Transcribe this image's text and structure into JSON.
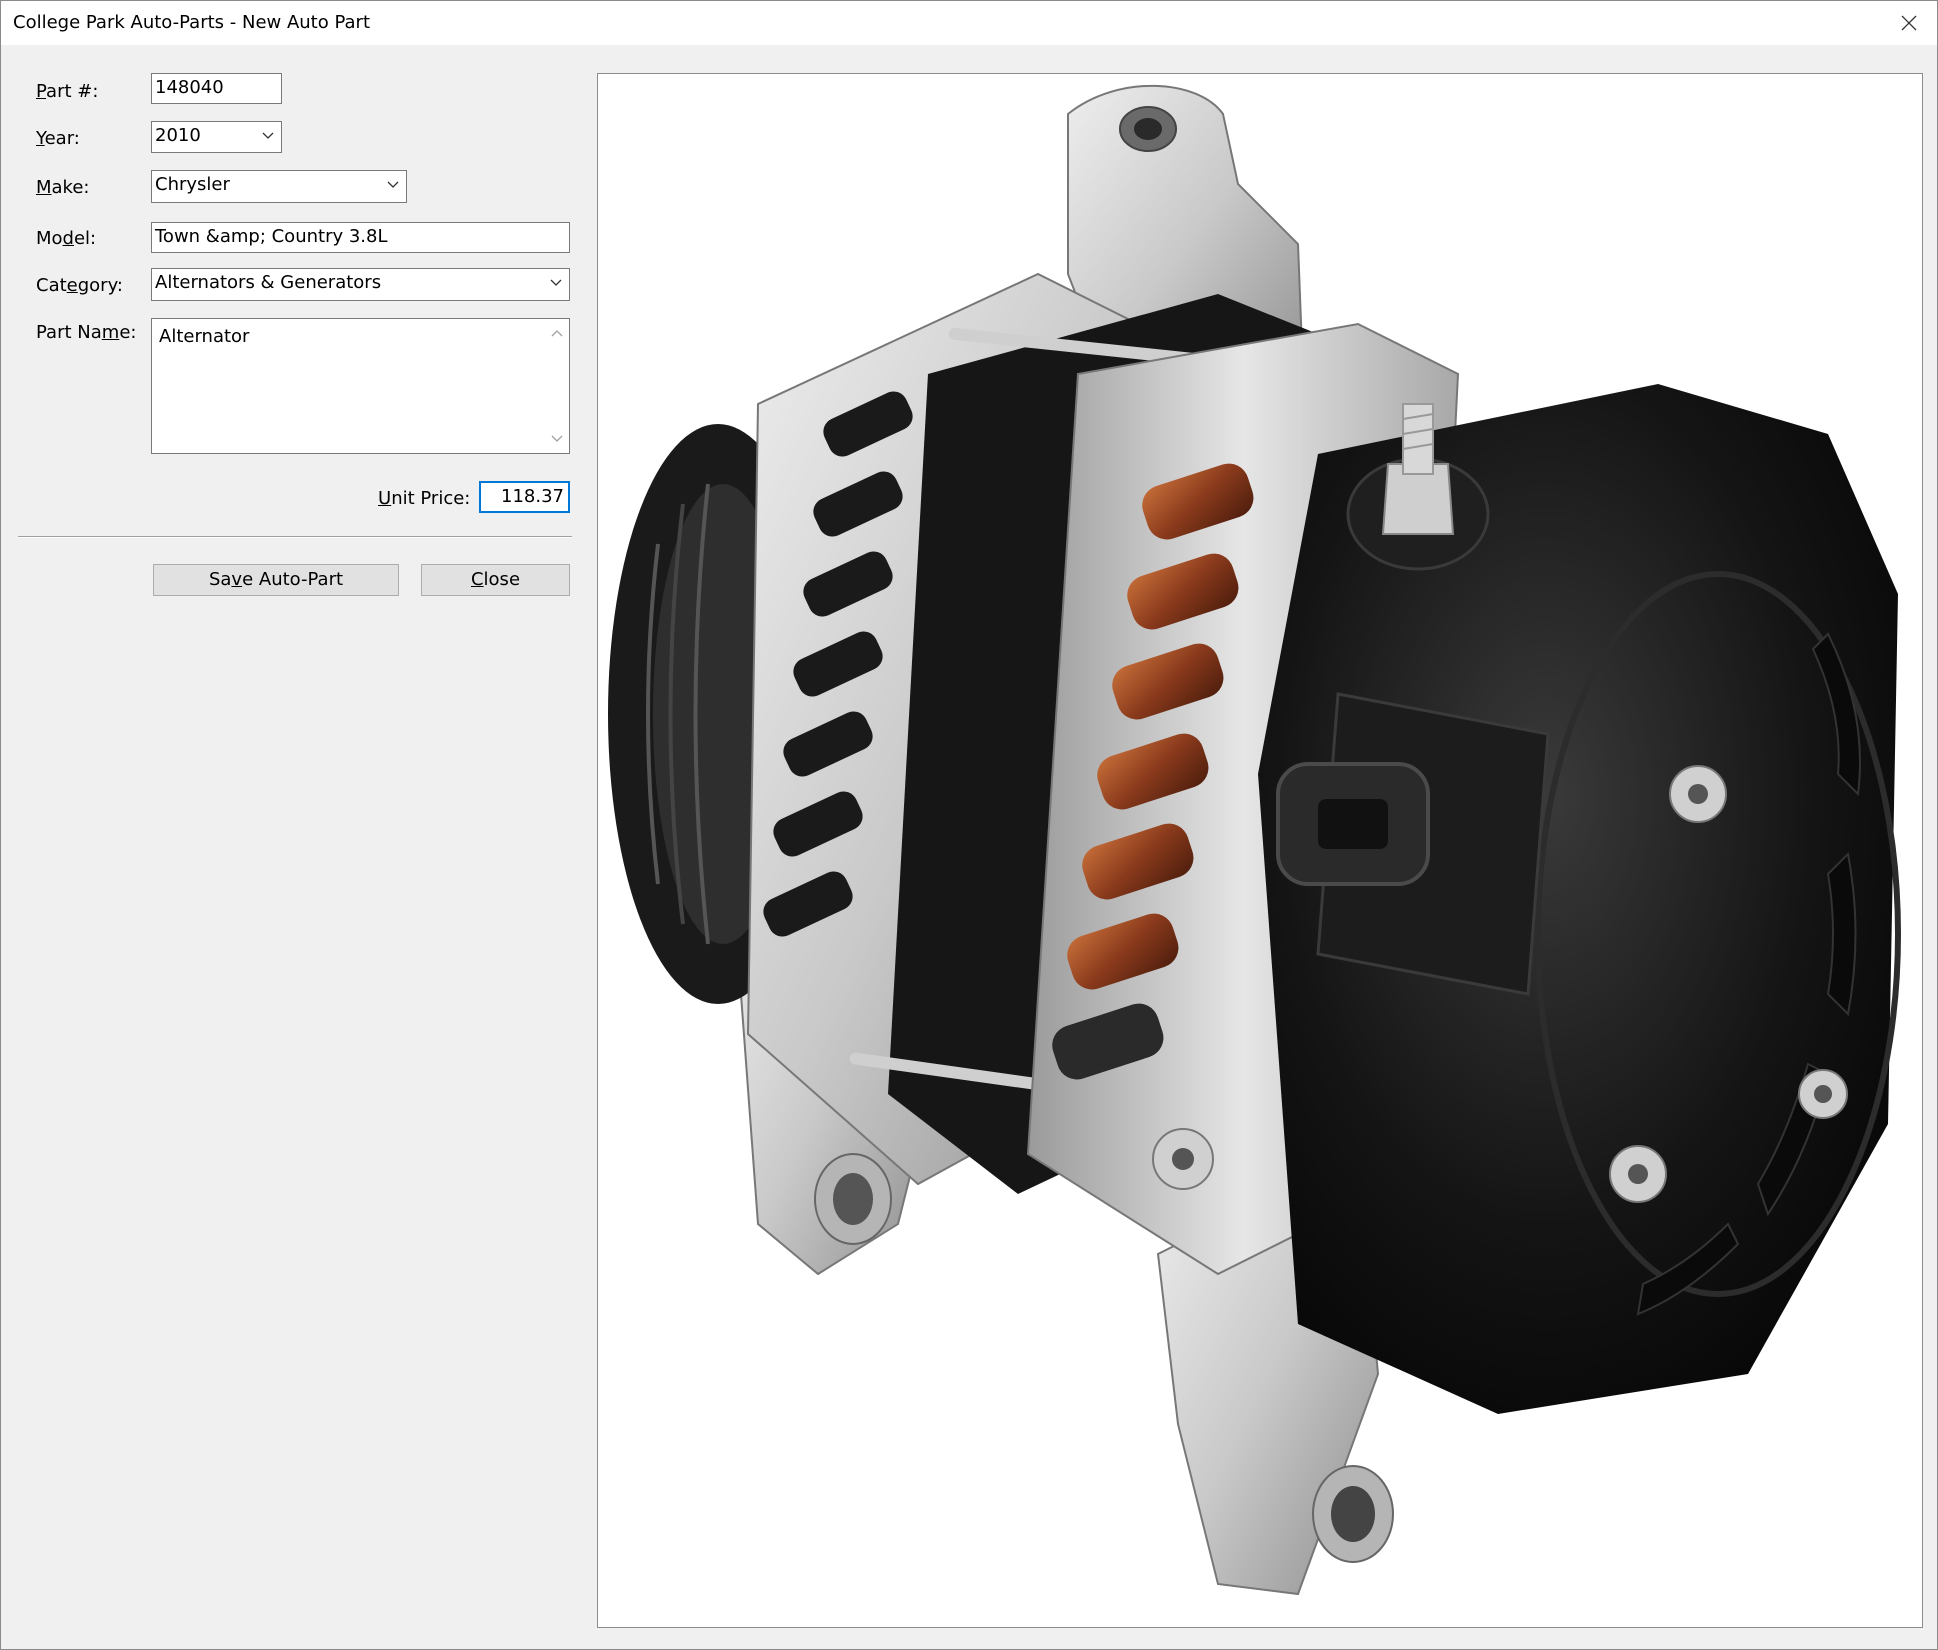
{
  "window": {
    "title": "College Park Auto-Parts - New Auto Part",
    "close_glyph": "✕"
  },
  "form": {
    "part_number": {
      "label_key": "P",
      "label_rest": "art #:",
      "value": "148040"
    },
    "year": {
      "label_key": "Y",
      "label_rest": "ear:",
      "value": "2010"
    },
    "make": {
      "label_key": "M",
      "label_rest": "ake:",
      "value": "Chrysler"
    },
    "model": {
      "label_pre": "Mo",
      "label_key": "d",
      "label_rest": "el:",
      "value": "Town &amp; Country 3.8L"
    },
    "category": {
      "label_pre": "Cat",
      "label_key": "e",
      "label_rest": "gory:",
      "value": "Alternators & Generators"
    },
    "part_name": {
      "label_pre": "Part Na",
      "label_key": "m",
      "label_rest": "e:",
      "value": "Alternator"
    },
    "unit_price": {
      "label_key": "U",
      "label_rest": "nit Price:",
      "value": "118.37"
    }
  },
  "buttons": {
    "save": {
      "pre": "Sa",
      "key": "v",
      "rest": "e Auto-Part"
    },
    "close": {
      "pre": "",
      "key": "C",
      "rest": "lose"
    }
  },
  "picture": {
    "subject": "alternator",
    "colors": {
      "aluminum": "#c9c9c9",
      "housing": "#111111",
      "copper": "#8a3a1c"
    }
  }
}
